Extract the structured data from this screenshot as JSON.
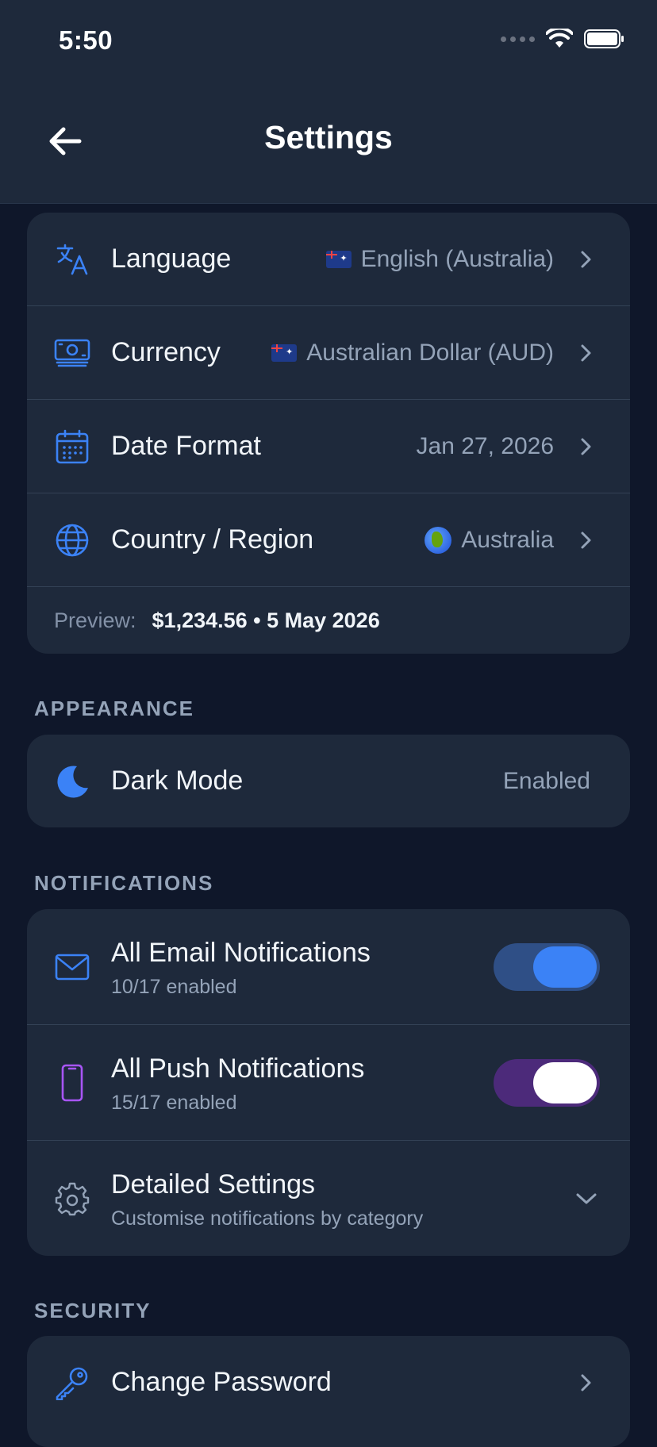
{
  "status_bar": {
    "time": "5:50"
  },
  "header": {
    "title": "Settings"
  },
  "regional": {
    "language": {
      "label": "Language",
      "value": "English (Australia)"
    },
    "currency": {
      "label": "Currency",
      "value": "Australian Dollar (AUD)"
    },
    "date_format": {
      "label": "Date Format",
      "value": "Jan 27, 2026"
    },
    "country": {
      "label": "Country / Region",
      "value": "Australia"
    },
    "preview": {
      "label": "Preview:",
      "value": "$1,234.56 • 5 May 2026"
    }
  },
  "appearance": {
    "section_label": "APPEARANCE",
    "dark_mode": {
      "label": "Dark Mode",
      "value": "Enabled"
    }
  },
  "notifications": {
    "section_label": "NOTIFICATIONS",
    "email": {
      "title": "All Email Notifications",
      "subtitle": "10/17 enabled",
      "on": true
    },
    "push": {
      "title": "All Push Notifications",
      "subtitle": "15/17 enabled",
      "on": true
    },
    "detailed": {
      "title": "Detailed Settings",
      "subtitle": "Customise notifications by category"
    }
  },
  "security": {
    "section_label": "SECURITY",
    "change_password": {
      "label": "Change Password"
    }
  },
  "colors": {
    "background": "#0f172a",
    "card": "#1e293b",
    "accent_blue": "#3b82f6",
    "accent_purple": "#a855f7"
  }
}
